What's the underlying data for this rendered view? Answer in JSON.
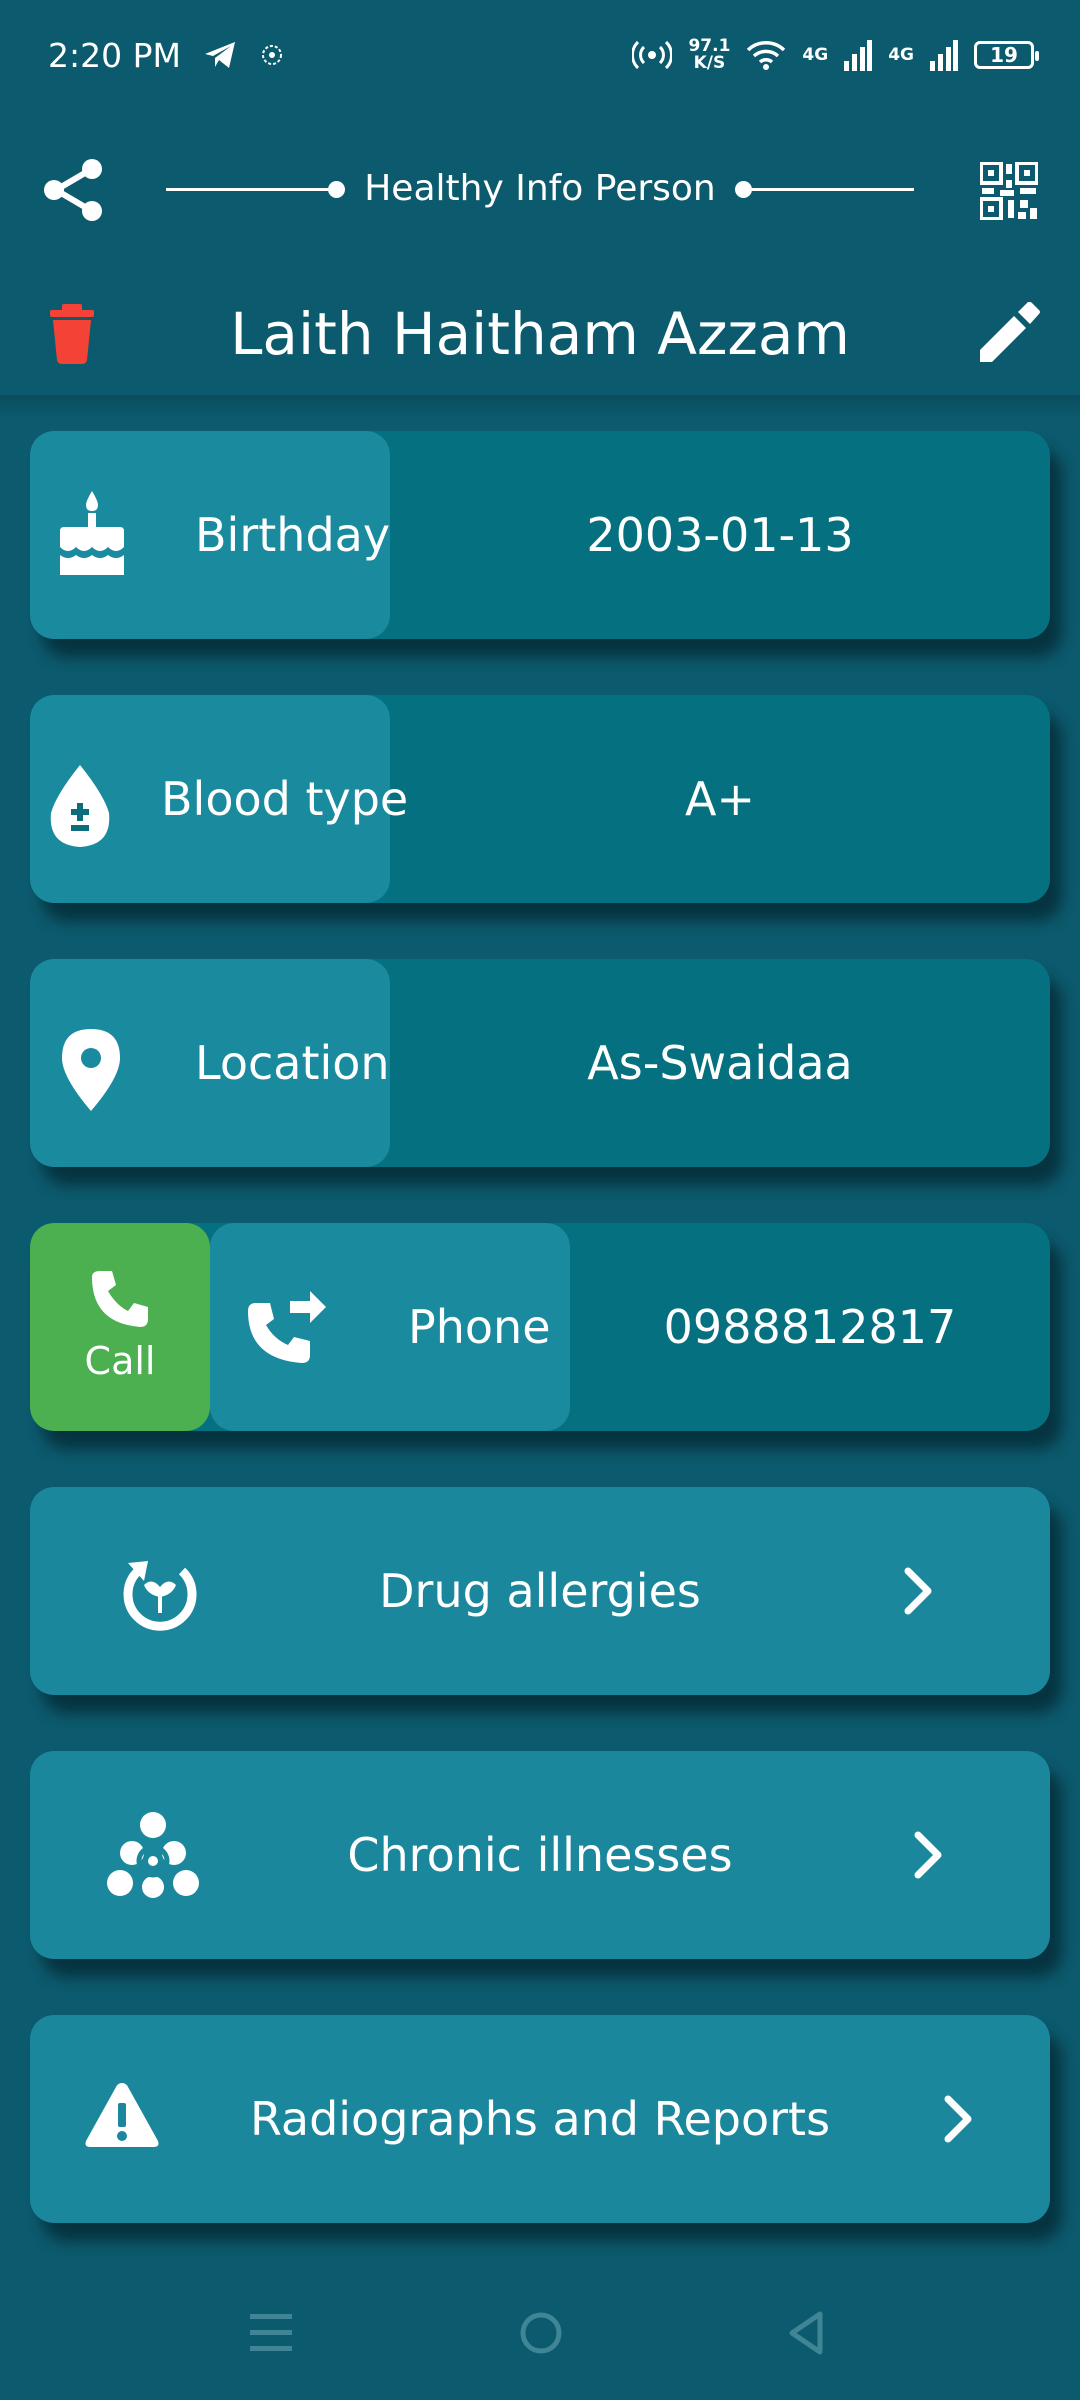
{
  "status_bar": {
    "time": "2:20 PM",
    "net_speed_value": "97.1",
    "net_speed_unit": "K/S",
    "network1": "4G",
    "network2": "4G",
    "battery": "19"
  },
  "header": {
    "title": "Healthy Info Person"
  },
  "person": {
    "name": "Laith Haitham Azzam"
  },
  "fields": {
    "birthday": {
      "label": "Birthday",
      "value": "2003-01-13"
    },
    "blood_type": {
      "label": "Blood type",
      "value": "A+"
    },
    "location": {
      "label": "Location",
      "value": "As-Swaidaa"
    },
    "phone": {
      "label": "Phone",
      "value": "0988812817",
      "call_label": "Call"
    }
  },
  "sections": [
    {
      "label": "Drug allergies"
    },
    {
      "label": "Chronic illnesses"
    },
    {
      "label": "Radiographs and Reports"
    }
  ],
  "colors": {
    "background": "#0c5a6d",
    "card": "#05707f",
    "label_box": "#1a8a9e",
    "call": "#4caf50",
    "delete": "#f44336"
  }
}
